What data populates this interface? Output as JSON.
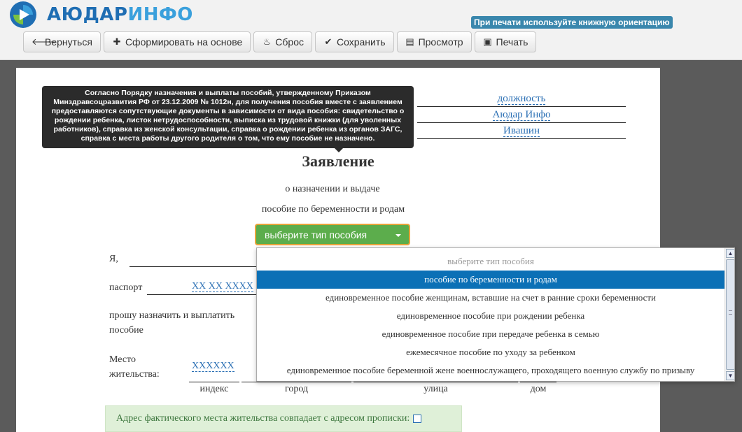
{
  "brand": {
    "part1": "АЮДАР",
    "part2": "ИНФО"
  },
  "print_hint": "При печати используйте книжную ориентацию",
  "toolbar": {
    "back": "Вернуться",
    "create": "Сформировать на основе",
    "reset": "Сброс",
    "save": "Сохранить",
    "preview": "Просмотр",
    "print": "Печать"
  },
  "header_fields": {
    "position": "должность",
    "company": "Аюдар Инфо",
    "name": "Ивашин"
  },
  "tooltip": "Согласно Порядку назначения и выплаты пособий, утвержденному Приказом Минздравсоцразвития РФ от 23.12.2009 № 1012н, для получения пособия вместе с заявлением предоставляются сопутствующие документы в зависимости от вида пособия: свидетельство о рождении ребенка, листок нетрудоспособности, выписка из трудовой книжки (для уволенных работников), справка из женской консультации, справка о рождении ребенка из органов ЗАГС, справка с места работы другого родителя о том, что ему пособие не назначено.",
  "document": {
    "title": "Заявление",
    "subtitle1": "о назначении и выдаче",
    "subtitle2": "пособие по беременности и родам"
  },
  "benefit_select": {
    "value": "выберите тип пособия",
    "options": [
      "выберите тип пособия",
      "пособие по беременности и родам",
      "единовременное пособие женщинам, вставшие на счет в ранние сроки беременности",
      "единовременное пособие при рождении ребенка",
      "единовременное пособие при передаче ребенка в семью",
      "ежемесячное пособие по уходу за ребенком",
      "единовременное пособие беременной жене военнослужащего, проходящего военную службу по призыву"
    ],
    "selected_index": 1
  },
  "form": {
    "i_label": "Я,",
    "passport_label": "паспорт",
    "passport_value": "XX XX XXXX",
    "request_line1": "прошу назначить и выплатить",
    "request_line2": "пособие",
    "residence_line1": "Место",
    "residence_line2": "жительства:",
    "residence_value": "XXXXXX",
    "address_labels": {
      "index": "индекс",
      "city": "город",
      "street": "улица",
      "house": "дом"
    },
    "same_address": "Адрес фактического места жительства совпадает с адресом прописки:"
  },
  "colors": {
    "brand_dark": "#1f6eb3",
    "brand_light": "#3aa0dc",
    "select_green": "#5cad4c",
    "selected_blue": "#0b70b6"
  }
}
